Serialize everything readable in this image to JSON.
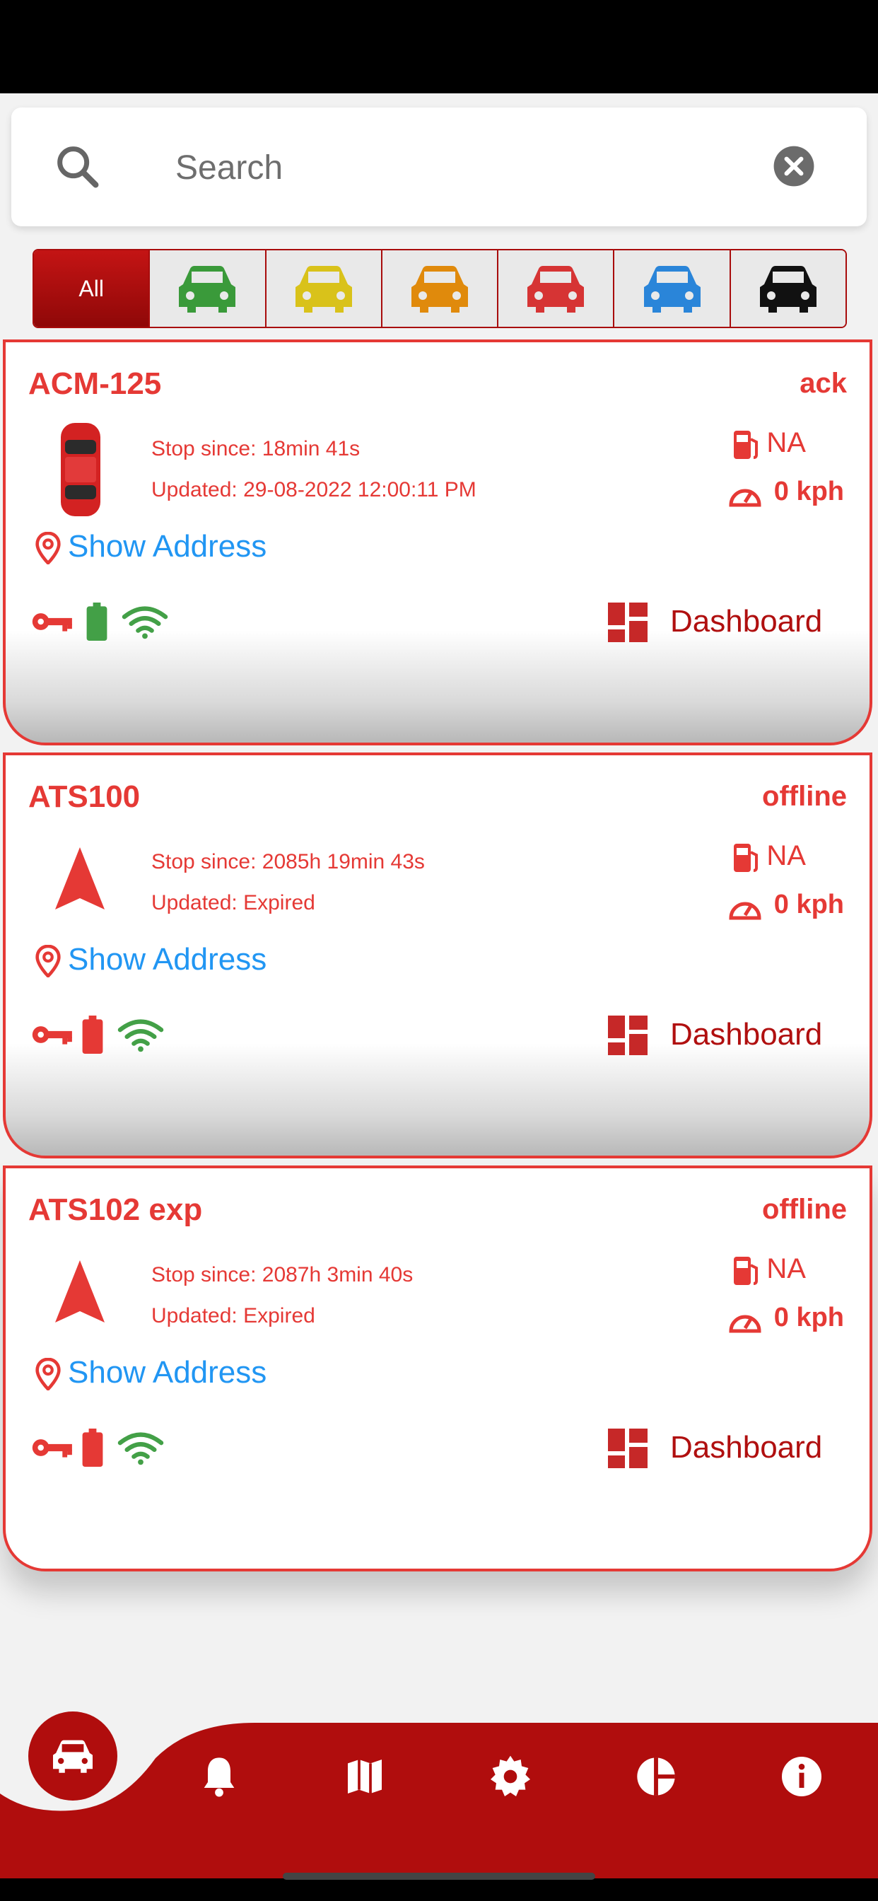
{
  "search": {
    "placeholder": "Search"
  },
  "filters": {
    "all_label": "All",
    "colors": [
      "#3a9a3a",
      "#d9c21a",
      "#e08a0c",
      "#d63434",
      "#2a85d9",
      "#111111"
    ]
  },
  "vehicles": [
    {
      "name": "ACM-125",
      "status": "ack",
      "stop_since": "Stop since: 18min 41s",
      "updated": "Updated: 29-08-2022 12:00:11 PM",
      "fuel": "NA",
      "speed": "0 kph",
      "address_label": "Show Address",
      "dashboard_label": "Dashboard",
      "icon": "red-car",
      "battery_color": "#43a047"
    },
    {
      "name": "ATS100",
      "status": "offline",
      "stop_since": "Stop since: 2085h 19min 43s",
      "updated": "Updated: Expired",
      "fuel": "NA",
      "speed": "0 kph",
      "address_label": "Show Address",
      "dashboard_label": "Dashboard",
      "icon": "red-arrow",
      "battery_color": "#e53935"
    },
    {
      "name": "ATS102 exp",
      "status": "offline",
      "stop_since": "Stop since: 2087h 3min 40s",
      "updated": "Updated: Expired",
      "fuel": "NA",
      "speed": "0 kph",
      "address_label": "Show Address",
      "dashboard_label": "Dashboard",
      "icon": "red-arrow",
      "battery_color": "#e53935"
    }
  ],
  "bottom_nav": {
    "items": [
      "car-icon",
      "bell-icon",
      "map-icon",
      "gear-icon",
      "pie-chart-icon",
      "info-icon"
    ],
    "color": "#b00d0d"
  }
}
